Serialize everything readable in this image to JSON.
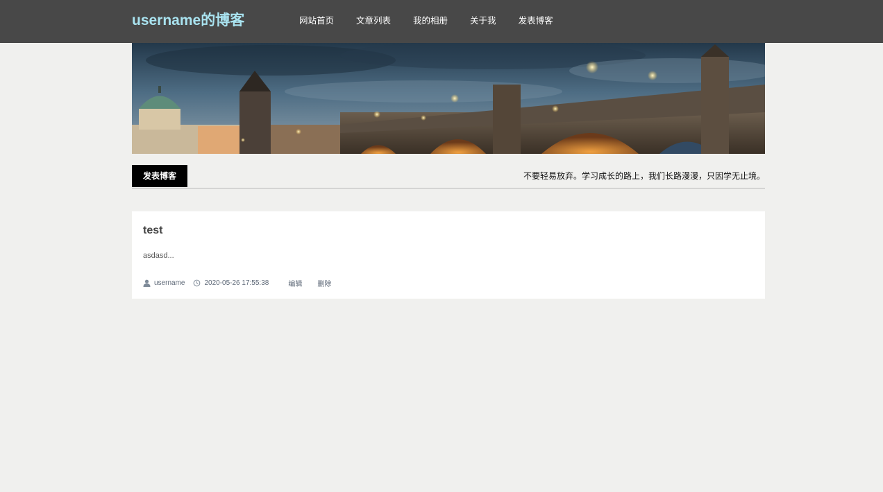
{
  "header": {
    "brand": "username的博客",
    "nav": [
      {
        "label": "网站首页"
      },
      {
        "label": "文章列表"
      },
      {
        "label": "我的相册"
      },
      {
        "label": "关于我"
      },
      {
        "label": "发表博客"
      }
    ]
  },
  "subbar": {
    "active_tab": "发表博客",
    "motto": "不要轻易放弃。学习成长的路上，我们长路漫漫，只因学无止境。"
  },
  "posts": [
    {
      "title": "test",
      "excerpt": "asdasd...",
      "author": "username",
      "datetime": "2020-05-26 17:55:38",
      "edit_label": "编辑",
      "delete_label": "删除"
    }
  ],
  "icons": {
    "author": "user-icon",
    "time": "clock-icon"
  },
  "colors": {
    "topbar": "#484848",
    "brand": "#a9e3f0",
    "page_bg": "#f0f0ee",
    "tab_active": "#000000"
  }
}
